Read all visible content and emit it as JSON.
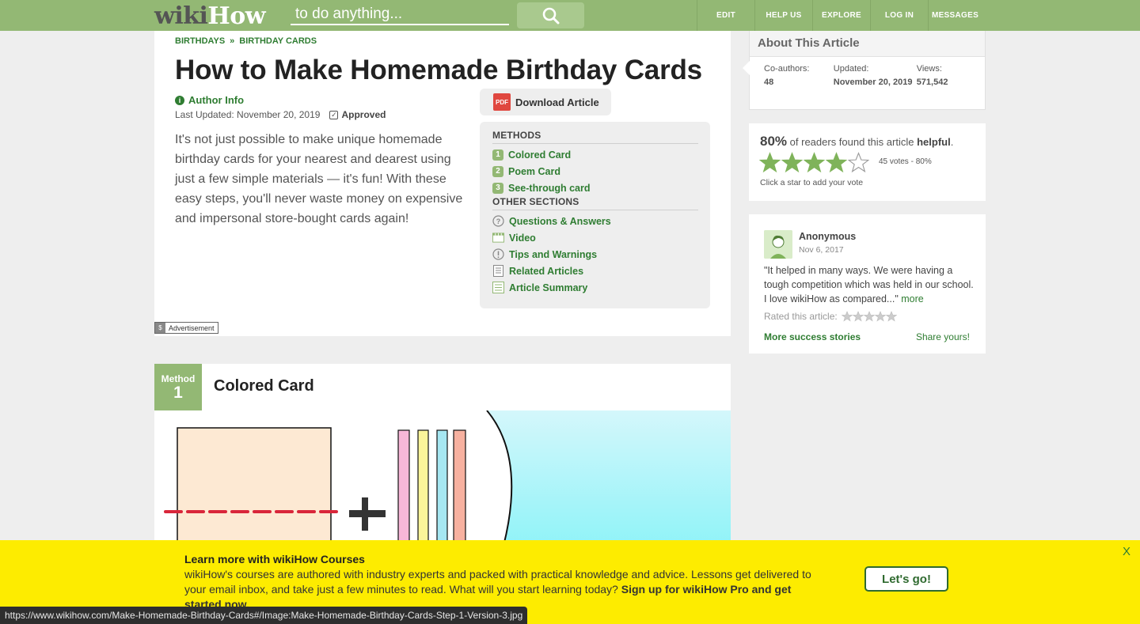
{
  "header": {
    "logo_wiki": "wiki",
    "logo_how": "How",
    "search_placeholder": "to do anything...",
    "nav": [
      "EDIT",
      "HELP US",
      "EXPLORE",
      "LOG IN",
      "MESSAGES"
    ]
  },
  "article": {
    "breadcrumb": [
      "BIRTHDAYS",
      "BIRTHDAY CARDS"
    ],
    "breadcrumb_sep": "»",
    "title": "How to Make Homemade Birthday Cards",
    "author_info": "Author Info",
    "last_updated": "Last Updated: November 20, 2019",
    "approved": "Approved",
    "intro": "It's not just possible to make unique homemade birthday cards for your nearest and dearest using just a few simple materials — it's fun! With these easy steps, you'll never waste money on expensive and impersonal store-bought cards again!",
    "download_label": "Download Article",
    "pdf_label": "PDF",
    "advertisement": "Advertisement",
    "ad_icon": "$"
  },
  "toc": {
    "methods_heading": "METHODS",
    "methods": [
      {
        "num": "1",
        "label": "Colored Card"
      },
      {
        "num": "2",
        "label": "Poem Card"
      },
      {
        "num": "3",
        "label": "See-through card"
      }
    ],
    "other_heading": "OTHER SECTIONS",
    "other": [
      {
        "icon": "question-icon",
        "label": "Questions & Answers"
      },
      {
        "icon": "video-icon",
        "label": "Video"
      },
      {
        "icon": "warning-icon",
        "label": "Tips and Warnings"
      },
      {
        "icon": "document-icon",
        "label": "Related Articles"
      },
      {
        "icon": "summary-icon",
        "label": "Article Summary"
      }
    ]
  },
  "method": {
    "label": "Method",
    "number": "1",
    "title": "Colored Card"
  },
  "about": {
    "title": "About This Article",
    "coauthors_label": "Co-authors:",
    "coauthors_value": "48",
    "updated_label": "Updated:",
    "updated_value": "November 20, 2019",
    "views_label": "Views:",
    "views_value": "571,542"
  },
  "helpful": {
    "percent": "80%",
    "text_before": "of readers found this article",
    "text_bold": "helpful",
    "text_end": ".",
    "votes": "45 votes - 80%",
    "rating_value": 4,
    "rating_max": 5,
    "hint": "Click a star to add your vote"
  },
  "story": {
    "name": "Anonymous",
    "date": "Nov 6, 2017",
    "text": "\"It helped in many ways. We were having a tough competition which was held in our school. I love wikiHow as compared...\"",
    "more": "more",
    "rated_label": "Rated this article:",
    "more_stories": "More success stories",
    "share": "Share yours!"
  },
  "banner": {
    "title": "Learn more with wikiHow Courses",
    "body": "wikiHow's courses are authored with industry experts and packed with practical knowledge and advice. Lessons get delivered to your email inbox, and take just a few minutes to read. What will you start learning today?",
    "body_bold": "Sign up for wikiHow Pro and get started now.",
    "button": "Let's go!",
    "close": "X"
  },
  "status_url": "https://www.wikihow.com/Make-Homemade-Birthday-Cards#/Image:Make-Homemade-Birthday-Cards-Step-1-Version-3.jpg",
  "colors": {
    "header_green": "#93b874",
    "link_green": "#2f7d32",
    "banner_yellow": "#fdec00",
    "star_green": "#7fb35a"
  }
}
